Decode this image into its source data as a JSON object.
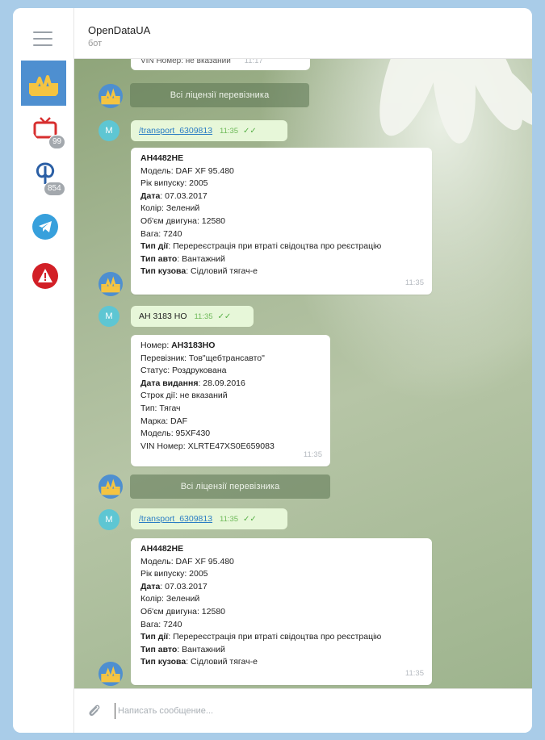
{
  "header": {
    "title": "OpenDataUA",
    "subtitle": "бот"
  },
  "sidebar": {
    "badges": {
      "tv": "99",
      "fin": "854"
    }
  },
  "top_strip": {
    "text": "VIN Номер: не вказаний",
    "time": "11:17"
  },
  "messages": {
    "btn1": "Всі ліцензії перевізника",
    "out1": {
      "text": "/transport_6309813",
      "time": "11:35"
    },
    "card1": {
      "lines": [
        {
          "label": "АН4482НЕ",
          "value": ""
        },
        {
          "label": "",
          "value": "Модель: DAF XF 95.480"
        },
        {
          "label": "",
          "value": "Рік випуску: 2005"
        },
        {
          "label": "Дата",
          "value": ": 07.03.2017"
        },
        {
          "label": "",
          "value": "Колір: Зелений"
        },
        {
          "label": "",
          "value": "Об'єм двигуна: 12580"
        },
        {
          "label": "",
          "value": "Вага: 7240"
        },
        {
          "label": "Тип дії",
          "value": ": Перереєстрація при втраті свідоцтва про реєстрацію"
        },
        {
          "label": "Тип авто",
          "value": ": Вантажний"
        },
        {
          "label": "Тип кузова",
          "value": ": Сідловий тягач-е"
        }
      ],
      "time": "11:35"
    },
    "out2": {
      "text": "АН 3183 НО",
      "time": "11:35"
    },
    "card2": {
      "lines": [
        {
          "label": "",
          "value": "Номер: ",
          "bold_value": "АН3183НО"
        },
        {
          "label": "",
          "value": "Перевізник: Тов\"щебтрансавто\""
        },
        {
          "label": "",
          "value": "Статус: Роздрукована"
        },
        {
          "label": "Дата видання",
          "value": ": 28.09.2016"
        },
        {
          "label": "",
          "value": "Строк дії: не вказаний"
        },
        {
          "label": "",
          "value": "Тип: Тягач"
        },
        {
          "label": "",
          "value": "Марка: DAF"
        },
        {
          "label": "",
          "value": "Модель: 95XF430"
        },
        {
          "label": "",
          "value": "VIN Номер: XLRTE47XS0E659083"
        }
      ],
      "time": "11:35"
    },
    "btn2": "Всі ліцензії перевізника",
    "out3": {
      "text": "/transport_6309813",
      "time": "11:35"
    },
    "card3": {
      "lines": [
        {
          "label": "АН4482НЕ",
          "value": ""
        },
        {
          "label": "",
          "value": "Модель: DAF XF 95.480"
        },
        {
          "label": "",
          "value": "Рік випуску: 2005"
        },
        {
          "label": "Дата",
          "value": ": 07.03.2017"
        },
        {
          "label": "",
          "value": "Колір: Зелений"
        },
        {
          "label": "",
          "value": "Об'єм двигуна: 12580"
        },
        {
          "label": "",
          "value": "Вага: 7240"
        },
        {
          "label": "Тип дії",
          "value": ": Перереєстрація при втраті свідоцтва про реєстрацію"
        },
        {
          "label": "Тип авто",
          "value": ": Вантажний"
        },
        {
          "label": "Тип кузова",
          "value": ": Сідловий тягач-е"
        }
      ],
      "time": "11:35"
    },
    "user_avatar_letter": "M"
  },
  "composer": {
    "placeholder": "Написать сообщение..."
  },
  "colors": {
    "accent": "#4e8fd0",
    "out_bubble": "#e7f7d9",
    "badge": "#a3a8ad"
  }
}
